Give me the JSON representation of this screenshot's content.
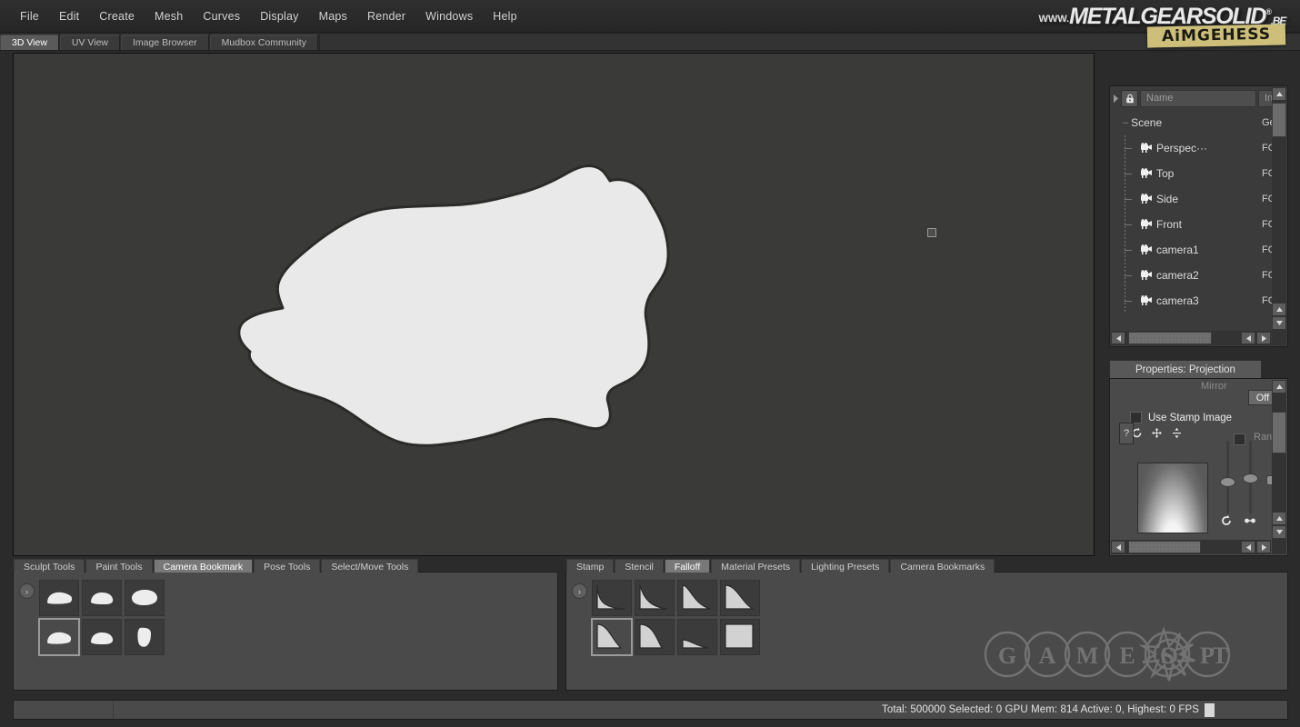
{
  "app": {
    "title": "Mudbox",
    "menu": [
      "File",
      "Edit",
      "Create",
      "Mesh",
      "Curves",
      "Display",
      "Maps",
      "Render",
      "Windows",
      "Help"
    ],
    "view_tabs": [
      {
        "label": "3D View",
        "active": true
      },
      {
        "label": "UV View",
        "active": false
      },
      {
        "label": "Image Browser",
        "active": false
      },
      {
        "label": "Mudbox Community",
        "active": false
      }
    ]
  },
  "watermarks": {
    "mgs_www": "WWW.",
    "mgs_main": "METALGEARSOLID",
    "mgs_reg": "®",
    "mgs_tld": ".BE",
    "sticker": "AiMGEHESS",
    "gamespot": "GAMESPOT"
  },
  "object_list": {
    "icon": "lock-icon",
    "columns": [
      "Name",
      "Inf"
    ],
    "rows": [
      {
        "label": "Scene",
        "info": "Ge",
        "depth": 0,
        "icon": "none"
      },
      {
        "label": "Perspec···",
        "info": "FO'",
        "depth": 1,
        "icon": "camera-icon"
      },
      {
        "label": "Top",
        "info": "FO'",
        "depth": 1,
        "icon": "camera-icon"
      },
      {
        "label": "Side",
        "info": "FO'",
        "depth": 1,
        "icon": "camera-icon"
      },
      {
        "label": "Front",
        "info": "FO'",
        "depth": 1,
        "icon": "camera-icon"
      },
      {
        "label": "camera1",
        "info": "FO'",
        "depth": 1,
        "icon": "camera-icon"
      },
      {
        "label": "camera2",
        "info": "FO'",
        "depth": 1,
        "icon": "camera-icon"
      },
      {
        "label": "camera3",
        "info": "FO'",
        "depth": 1,
        "icon": "camera-icon"
      }
    ]
  },
  "properties": {
    "tab_label": "Properties: Projection",
    "mirror_label": "Mirror",
    "mirror_value": "Off",
    "use_stamp_label": "Use Stamp Image",
    "random_label": "Rand",
    "help_glyph": "?",
    "icons": [
      "rotate-icon",
      "move-icon",
      "flip-vertical-icon",
      "rotate-ccw-icon",
      "flip-horizontal-icon"
    ]
  },
  "left_tray": {
    "tabs": [
      {
        "label": "Sculpt Tools",
        "active": false
      },
      {
        "label": "Paint Tools",
        "active": false
      },
      {
        "label": "Camera Bookmark",
        "active": true
      },
      {
        "label": "Pose Tools",
        "active": false
      },
      {
        "label": "Select/Move Tools",
        "active": false
      }
    ],
    "expander": "›",
    "thumbnails": [
      {
        "name": "camera-bookmark-1",
        "selected": false
      },
      {
        "name": "camera-bookmark-2",
        "selected": false
      },
      {
        "name": "camera-bookmark-3",
        "selected": false
      },
      {
        "name": "camera-bookmark-4",
        "selected": true
      },
      {
        "name": "camera-bookmark-5",
        "selected": false
      },
      {
        "name": "camera-bookmark-6",
        "selected": false
      }
    ]
  },
  "right_tray": {
    "tabs": [
      {
        "label": "Stamp",
        "active": false
      },
      {
        "label": "Stencil",
        "active": false
      },
      {
        "label": "Falloff",
        "active": true
      },
      {
        "label": "Material Presets",
        "active": false
      },
      {
        "label": "Lighting Presets",
        "active": false
      },
      {
        "label": "Camera Bookmarks",
        "active": false
      }
    ],
    "expander": "›",
    "thumbnails": [
      {
        "name": "falloff-1",
        "selected": false
      },
      {
        "name": "falloff-2",
        "selected": false
      },
      {
        "name": "falloff-3",
        "selected": false
      },
      {
        "name": "falloff-4",
        "selected": false
      },
      {
        "name": "falloff-5",
        "selected": true
      },
      {
        "name": "falloff-6",
        "selected": false
      },
      {
        "name": "falloff-7",
        "selected": false
      },
      {
        "name": "falloff-8",
        "selected": false
      }
    ]
  },
  "status": {
    "total_label": "Total: 500000",
    "selected_label": "Selected: 0",
    "gpu_label": "GPU Mem: 814",
    "active_label": "Active: 0, Highest: 0",
    "fps_label": "FPS",
    "full": "Total: 500000  Selected: 0 GPU Mem: 814  Active: 0, Highest: 0  FPS"
  },
  "viewport": {
    "background": "#3a3a38",
    "model_color": "#e9e9e9",
    "model_outline": "#2a2a28"
  }
}
